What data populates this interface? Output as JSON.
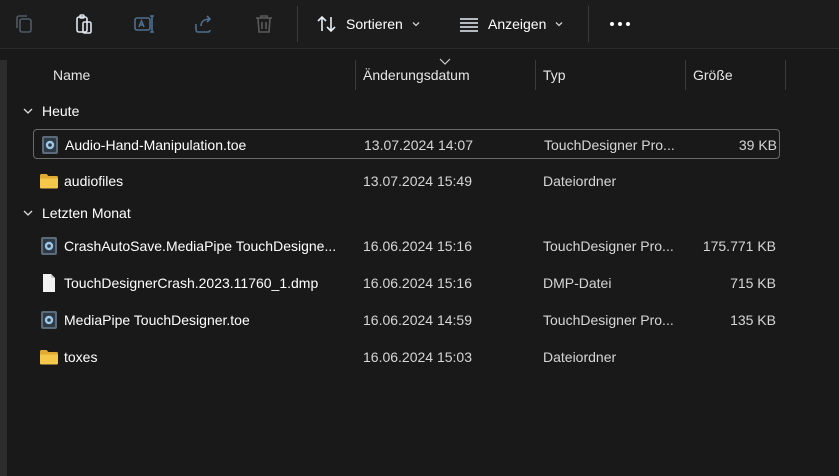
{
  "toolbar": {
    "icons": [
      "copy-icon",
      "paste-icon",
      "rename-icon",
      "share-icon",
      "delete-icon"
    ],
    "sort_label": "Sortieren",
    "view_label": "Anzeigen",
    "more": "more-options-icon"
  },
  "columns": {
    "name": "Name",
    "date": "Änderungsdatum",
    "type": "Typ",
    "size": "Größe"
  },
  "groups": [
    {
      "label": "Heute",
      "items": [
        {
          "name": "Audio-Hand-Manipulation.toe",
          "date": "13.07.2024 14:07",
          "type": "TouchDesigner Pro...",
          "size": "39 KB",
          "icon": "touchdesigner-file-icon"
        },
        {
          "name": "audiofiles",
          "date": "13.07.2024 15:49",
          "type": "Dateiordner",
          "size": "",
          "icon": "folder-icon"
        }
      ]
    },
    {
      "label": "Letzten Monat",
      "items": [
        {
          "name": "CrashAutoSave.MediaPipe TouchDesigne...",
          "date": "16.06.2024 15:16",
          "type": "TouchDesigner Pro...",
          "size": "175.771 KB",
          "icon": "touchdesigner-file-icon"
        },
        {
          "name": "TouchDesignerCrash.2023.11760_1.dmp",
          "date": "16.06.2024 15:16",
          "type": "DMP-Datei",
          "size": "715 KB",
          "icon": "file-icon"
        },
        {
          "name": "MediaPipe TouchDesigner.toe",
          "date": "16.06.2024 14:59",
          "type": "TouchDesigner Pro...",
          "size": "135 KB",
          "icon": "touchdesigner-file-icon"
        },
        {
          "name": "toxes",
          "date": "16.06.2024 15:03",
          "type": "Dateiordner",
          "size": "",
          "icon": "folder-icon"
        }
      ]
    }
  ],
  "colors": {
    "background": "#191919",
    "folder": "#f3c24c",
    "toolbar_icon_disabled": "#5a6470",
    "toolbar_icon": "#cfd8e3"
  }
}
